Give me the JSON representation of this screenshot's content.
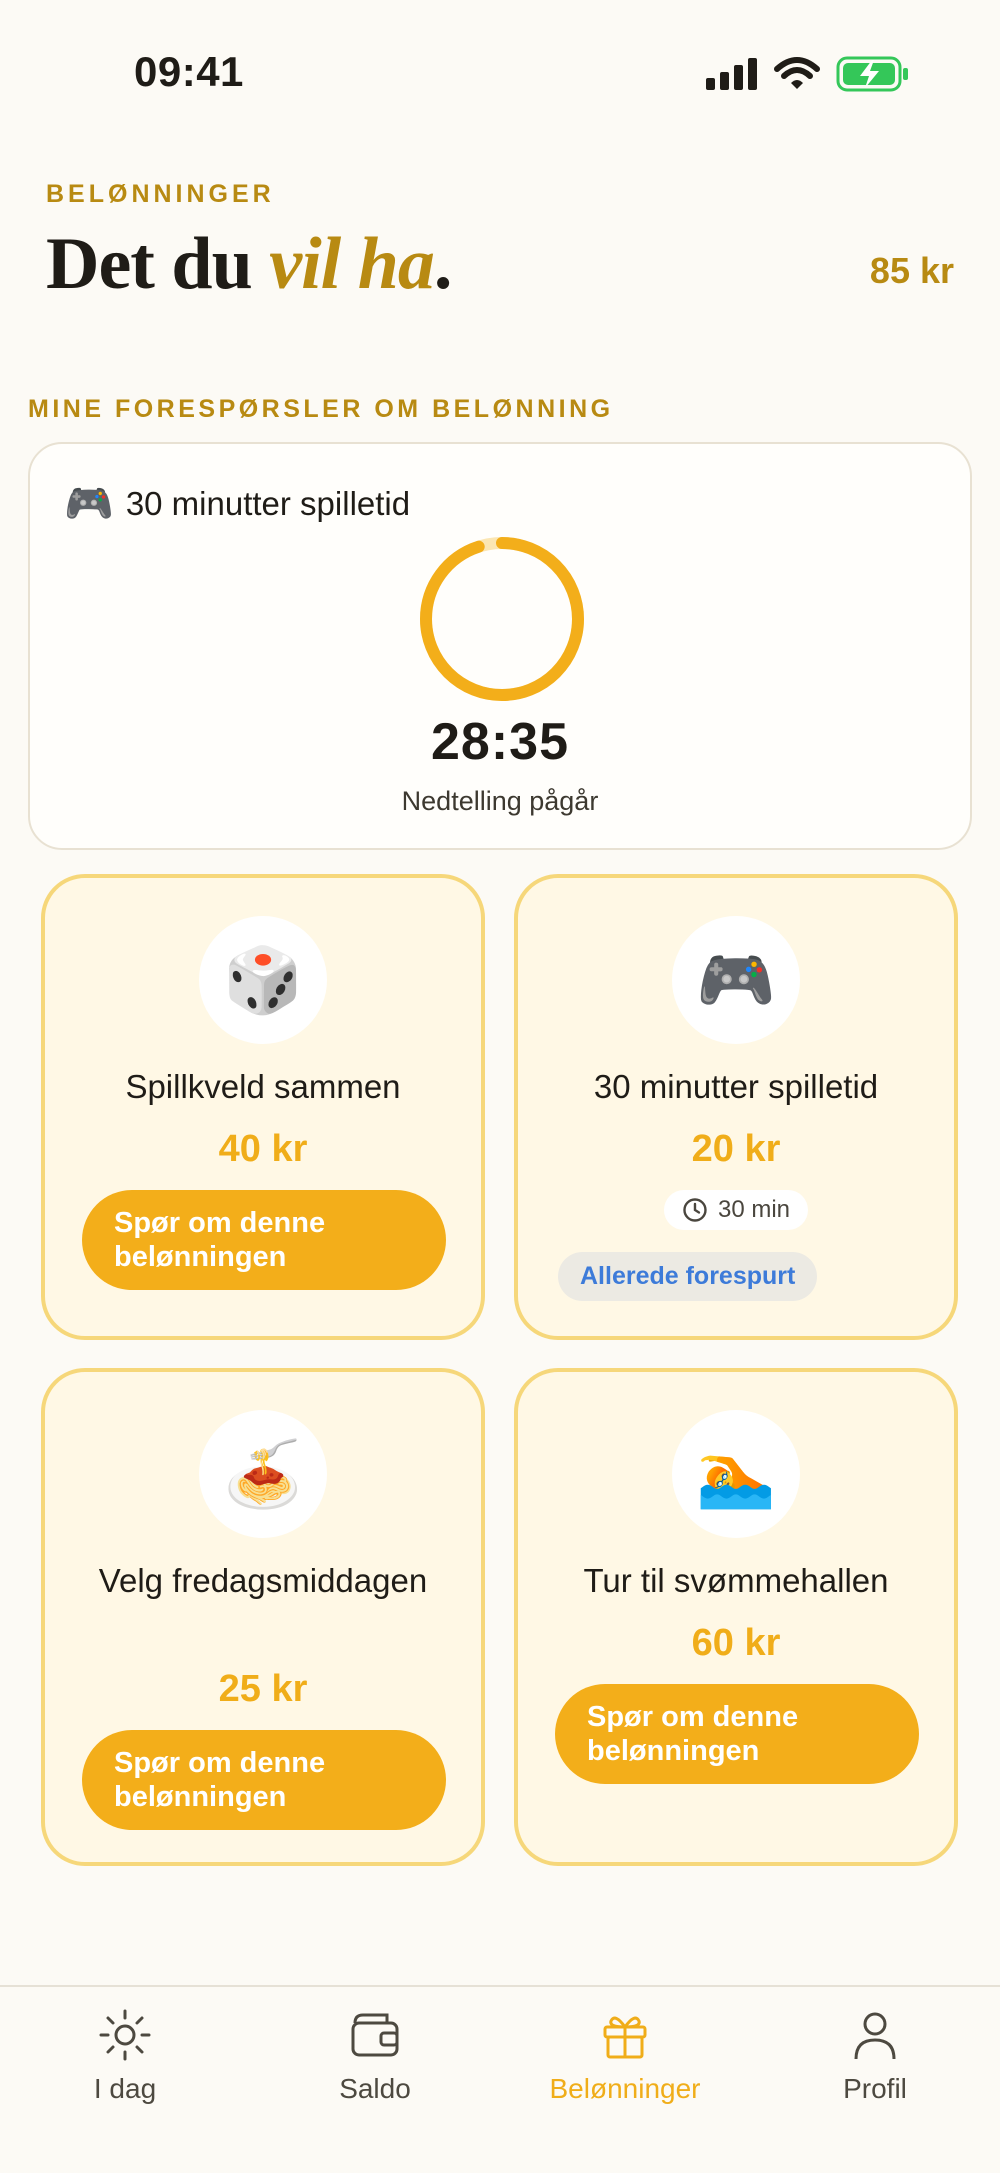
{
  "status": {
    "time": "09:41"
  },
  "header": {
    "eyebrow": "BELØNNINGER",
    "title_plain": "Det du ",
    "title_accent": "vil ha",
    "title_end": ".",
    "balance": "85 kr"
  },
  "requests": {
    "section_label": "MINE FORESPØRSLER OM BELØNNING",
    "active": {
      "emoji": "🎮",
      "title": "30 minutter spilletid",
      "timer": "28:35",
      "caption": "Nedtelling pågår",
      "progress": 0.95
    }
  },
  "rewards": [
    {
      "emoji": "🎲",
      "name": "Spillkveld sammen",
      "price": "40 kr",
      "button": "Spør om denne belønningen"
    },
    {
      "emoji": "🎮",
      "name": "30 minutter spilletid",
      "price": "20 kr",
      "duration": "30 min",
      "status": "Allerede forespurt"
    },
    {
      "emoji": "🍝",
      "name": "Velg fredagsmiddagen",
      "price": "25 kr",
      "button": "Spør om denne belønningen"
    },
    {
      "emoji": "🏊",
      "name": "Tur til svømmehallen",
      "price": "60 kr",
      "button": "Spør om denne belønningen"
    }
  ],
  "tabs": [
    {
      "label": "I dag",
      "icon": "sun-icon"
    },
    {
      "label": "Saldo",
      "icon": "wallet-icon"
    },
    {
      "label": "Belønninger",
      "icon": "gift-icon",
      "active": true
    },
    {
      "label": "Profil",
      "icon": "person-icon"
    }
  ],
  "colors": {
    "accent": "#f0ad19",
    "accent_dark": "#b88a12",
    "link": "#3d7bd9",
    "card_border": "#f6d77a"
  }
}
